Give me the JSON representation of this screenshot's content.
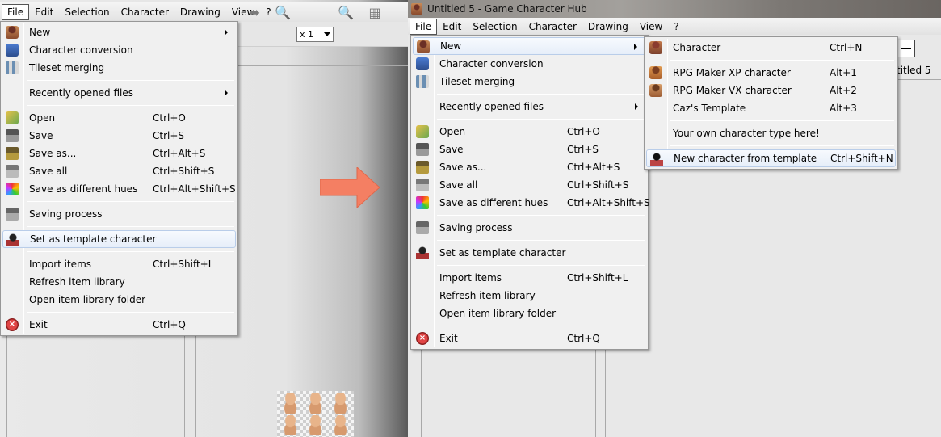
{
  "left": {
    "menubar": [
      "File",
      "Edit",
      "Selection",
      "Character",
      "Drawing",
      "View",
      "?"
    ],
    "zoom_value": "x 1",
    "file_menu": [
      {
        "label": "New",
        "shortcut": "",
        "submenu": true,
        "icon": "new-character-icon"
      },
      {
        "label": "Character conversion",
        "shortcut": "",
        "icon": "character-conversion-icon"
      },
      {
        "label": "Tileset merging",
        "shortcut": "",
        "icon": "tileset-merging-icon"
      },
      {
        "sep": true
      },
      {
        "label": "Recently opened files",
        "shortcut": "",
        "submenu": true,
        "icon": ""
      },
      {
        "sep": true
      },
      {
        "label": "Open",
        "shortcut": "Ctrl+O",
        "icon": "open-icon"
      },
      {
        "label": "Save",
        "shortcut": "Ctrl+S",
        "icon": "save-icon"
      },
      {
        "label": "Save as...",
        "shortcut": "Ctrl+Alt+S",
        "icon": "save-as-icon"
      },
      {
        "label": "Save all",
        "shortcut": "Ctrl+Shift+S",
        "icon": "save-all-icon"
      },
      {
        "label": "Save as different hues",
        "shortcut": "Ctrl+Alt+Shift+S",
        "icon": "hues-icon"
      },
      {
        "sep": true
      },
      {
        "label": "Saving process",
        "shortcut": "",
        "icon": "saving-process-icon"
      },
      {
        "sep": true
      },
      {
        "label": "Set as template character",
        "shortcut": "",
        "icon": "template-icon",
        "highlight": true
      },
      {
        "sep": true
      },
      {
        "label": "Import items",
        "shortcut": "Ctrl+Shift+L",
        "icon": ""
      },
      {
        "label": "Refresh item library",
        "shortcut": "",
        "icon": ""
      },
      {
        "label": "Open item library folder",
        "shortcut": "",
        "icon": ""
      },
      {
        "sep": true
      },
      {
        "label": "Exit",
        "shortcut": "Ctrl+Q",
        "icon": "exit-icon"
      }
    ]
  },
  "right": {
    "window_title": "Untitled 5 - Game Character Hub",
    "menubar": [
      "File",
      "Edit",
      "Selection",
      "Character",
      "Drawing",
      "View",
      "?"
    ],
    "doc_tab": "titled 5",
    "file_menu": [
      {
        "label": "New",
        "shortcut": "",
        "submenu": true,
        "icon": "new-character-icon",
        "highlight": true
      },
      {
        "label": "Character conversion",
        "shortcut": "",
        "icon": "character-conversion-icon"
      },
      {
        "label": "Tileset merging",
        "shortcut": "",
        "icon": "tileset-merging-icon"
      },
      {
        "sep": true
      },
      {
        "label": "Recently opened files",
        "shortcut": "",
        "submenu": true,
        "icon": ""
      },
      {
        "sep": true
      },
      {
        "label": "Open",
        "shortcut": "Ctrl+O",
        "icon": "open-icon"
      },
      {
        "label": "Save",
        "shortcut": "Ctrl+S",
        "icon": "save-icon"
      },
      {
        "label": "Save as...",
        "shortcut": "Ctrl+Alt+S",
        "icon": "save-as-icon"
      },
      {
        "label": "Save all",
        "shortcut": "Ctrl+Shift+S",
        "icon": "save-all-icon"
      },
      {
        "label": "Save as different hues",
        "shortcut": "Ctrl+Alt+Shift+S",
        "icon": "hues-icon"
      },
      {
        "sep": true
      },
      {
        "label": "Saving process",
        "shortcut": "",
        "icon": "saving-process-icon"
      },
      {
        "sep": true
      },
      {
        "label": "Set as template character",
        "shortcut": "",
        "icon": "template-icon"
      },
      {
        "sep": true
      },
      {
        "label": "Import items",
        "shortcut": "Ctrl+Shift+L",
        "icon": ""
      },
      {
        "label": "Refresh item library",
        "shortcut": "",
        "icon": ""
      },
      {
        "label": "Open item library folder",
        "shortcut": "",
        "icon": ""
      },
      {
        "sep": true
      },
      {
        "label": "Exit",
        "shortcut": "Ctrl+Q",
        "icon": "exit-icon"
      }
    ],
    "new_submenu": [
      {
        "label": "Character",
        "shortcut": "Ctrl+N",
        "icon": "character-icon"
      },
      {
        "sep": true
      },
      {
        "label": "RPG Maker XP character",
        "shortcut": "Alt+1",
        "icon": "rpg-maker-xp-icon"
      },
      {
        "label": "RPG Maker VX character",
        "shortcut": "Alt+2",
        "icon": "rpg-maker-vx-icon"
      },
      {
        "label": "Caz's Template",
        "shortcut": "Alt+3",
        "icon": ""
      },
      {
        "sep": true
      },
      {
        "label": "Your own character type here!",
        "shortcut": "",
        "icon": ""
      },
      {
        "sep": true
      },
      {
        "label": "New character from template",
        "shortcut": "Ctrl+Shift+N",
        "icon": "template-character-icon",
        "highlight": true
      }
    ]
  },
  "colors": {
    "arrow": "#f47f63",
    "highlight_border": "#b9cde9",
    "menu_bg": "#f0f0f0"
  }
}
